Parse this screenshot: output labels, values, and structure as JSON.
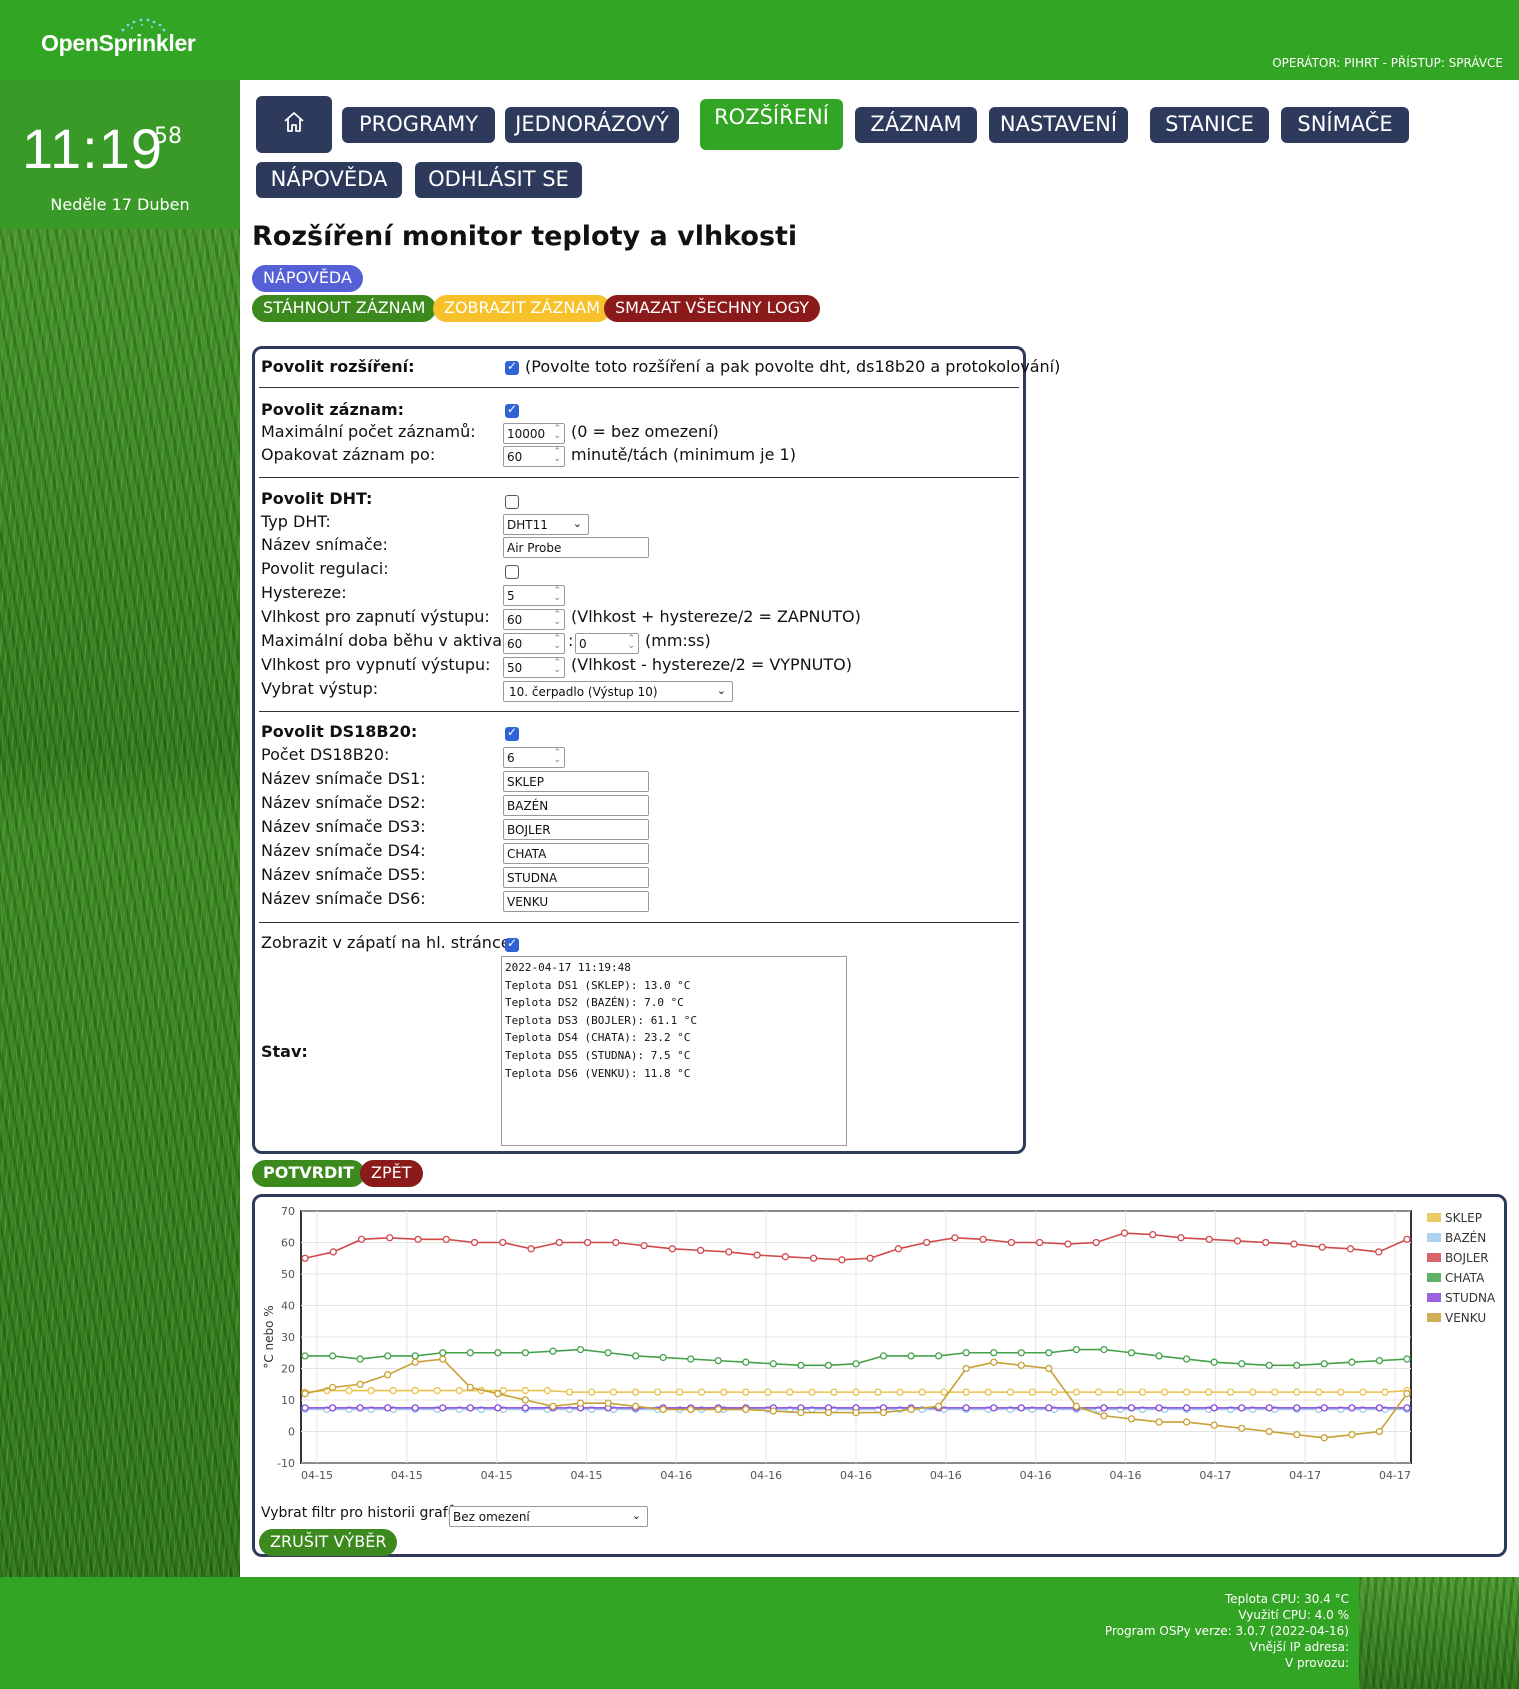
{
  "header": {
    "logo": "OpenSprinkler",
    "operator": "OPERÁTOR: PIHRT - PŘÍSTUP: SPRÁVCE"
  },
  "clock": {
    "time": "11:19",
    "seconds": "58",
    "date": "Neděle 17 Duben"
  },
  "nav": {
    "home_icon": "home-icon",
    "items": [
      "PROGRAMY",
      "JEDNORÁZOVÝ",
      "ROZŠÍŘENÍ",
      "ZÁZNAM",
      "NASTAVENÍ",
      "STANICE",
      "SNÍMAČE",
      "NÁPOVĚDA",
      "ODHLÁSIT SE"
    ],
    "active": "ROZŠÍŘENÍ"
  },
  "page": {
    "title": "Rozšíření monitor teploty a vlhkosti",
    "help_button": "NÁPOVĚDA",
    "download_log": "STÁHNOUT ZÁZNAM",
    "show_log": "ZOBRAZIT ZÁZNAM",
    "delete_logs": "SMAZAT VŠECHNY LOGY",
    "colors": {
      "help": "#5560d6",
      "download": "#3c8a1e",
      "show": "#f7c12b",
      "delete": "#8b1a1a",
      "nav": "#2e3a5c",
      "accent": "#33a524"
    }
  },
  "form": {
    "enable_label": "Povolit rozšíření:",
    "enable_checked": true,
    "enable_note": "(Povolte toto rozšíření a pak povolte dht, ds18b20 a protokolování)",
    "log_enable_label": "Povolit záznam:",
    "log_enable_checked": true,
    "max_records_label": "Maximální počet záznamů:",
    "max_records": "10000",
    "max_records_note": "(0 = bez omezení)",
    "repeat_label": "Opakovat záznam po:",
    "repeat": "60",
    "repeat_note": "minutě/tách (minimum je 1)",
    "dht_enable_label": "Povolit DHT:",
    "dht_enable_checked": false,
    "dht_type_label": "Typ DHT:",
    "dht_type": "DHT11",
    "sensor_name_label": "Název snímače:",
    "sensor_name": "Air Probe",
    "regulation_label": "Povolit regulaci:",
    "regulation_checked": false,
    "hysteresis_label": "Hystereze:",
    "hysteresis": "5",
    "humid_on_label": "Vlhkost pro zapnutí výstupu:",
    "humid_on": "60",
    "humid_on_note": "(Vlhkost + hystereze/2 = ZAPNUTO)",
    "max_run_label": "Maximální doba běhu v aktivaci:",
    "max_run_min": "60",
    "max_run_sep": ":",
    "max_run_sec": "0",
    "max_run_note": "(mm:ss)",
    "humid_off_label": "Vlhkost pro vypnutí výstupu:",
    "humid_off": "50",
    "humid_off_note": "(Vlhkost - hystereze/2 = VYPNUTO)",
    "output_label": "Vybrat výstup:",
    "output": "10. čerpadlo (Výstup 10)",
    "ds_enable_label": "Povolit DS18B20:",
    "ds_enable_checked": true,
    "ds_count_label": "Počet DS18B20:",
    "ds_count": "6",
    "ds_sensors": [
      {
        "label": "Název snímače DS1:",
        "value": "SKLEP"
      },
      {
        "label": "Název snímače DS2:",
        "value": "BAZÉN"
      },
      {
        "label": "Název snímače DS3:",
        "value": "BOJLER"
      },
      {
        "label": "Název snímače DS4:",
        "value": "CHATA"
      },
      {
        "label": "Název snímače DS5:",
        "value": "STUDNA"
      },
      {
        "label": "Název snímače DS6:",
        "value": "VENKU"
      }
    ],
    "footer_show_label": "Zobrazit v zápatí na hl. stránce:",
    "footer_show_checked": true,
    "status_label": "Stav:",
    "status_text": "2022-04-17 11:19:48\nTeplota DS1 (SKLEP): 13.0 °C\nTeplota DS2 (BAZÉN): 7.0 °C\nTeplota DS3 (BOJLER): 61.1 °C\nTeplota DS4 (CHATA): 23.2 °C\nTeplota DS5 (STUDNA): 7.5 °C\nTeplota DS6 (VENKU): 11.8 °C",
    "submit": "POTVRDIT",
    "back": "ZPĚT"
  },
  "chart_filter": {
    "label": "Vybrat filtr pro historii grafů:",
    "value": "Bez omezení",
    "clear_button": "ZRUŠIT VÝBĚR"
  },
  "chart_data": {
    "type": "line",
    "ylabel": "°C nebo %",
    "ylim": [
      -10,
      70
    ],
    "yticks": [
      -10,
      0,
      10,
      20,
      30,
      40,
      50,
      60,
      70
    ],
    "xticks": [
      "04-15",
      "04-15",
      "04-15",
      "04-15",
      "04-16",
      "04-16",
      "04-16",
      "04-16",
      "04-16",
      "04-16",
      "04-17",
      "04-17",
      "04-17"
    ],
    "grid": true,
    "legend_position": "right",
    "x": [
      0,
      1,
      2,
      3,
      4,
      5,
      6,
      7,
      8,
      9,
      10,
      11,
      12,
      13,
      14,
      15,
      16,
      17,
      18,
      19,
      20,
      21,
      22,
      23,
      24,
      25,
      26,
      27,
      28,
      29,
      30,
      31,
      32,
      33,
      34,
      35,
      36,
      37,
      38,
      39,
      40,
      41,
      42,
      43,
      44,
      45,
      46,
      47,
      48,
      49,
      50
    ],
    "series": [
      {
        "name": "SKLEP",
        "color": "#e8c24a",
        "values": [
          12.5,
          13,
          13,
          13,
          13,
          13,
          13,
          13,
          13,
          13,
          13,
          13,
          12.5,
          12.5,
          12.5,
          12.5,
          12.5,
          12.5,
          12.5,
          12.5,
          12.5,
          12.5,
          12.5,
          12.5,
          12.5,
          12.5,
          12.5,
          12.5,
          12.5,
          12.5,
          12.5,
          12.5,
          12.5,
          12.5,
          12.5,
          12.5,
          12.5,
          12.5,
          12.5,
          12.5,
          12.5,
          12.5,
          12.5,
          12.5,
          12.5,
          12.5,
          12.5,
          12.5,
          12.5,
          12.5,
          13
        ]
      },
      {
        "name": "BAZÉN",
        "color": "#9ecbee",
        "values": [
          7,
          7,
          7,
          7,
          7,
          7,
          7,
          7,
          7,
          7,
          7,
          7,
          7,
          7,
          7,
          7,
          7,
          7,
          7,
          7,
          7,
          7,
          7,
          7,
          7,
          7,
          7,
          7,
          7,
          7,
          7,
          7,
          7,
          7,
          7,
          7,
          7,
          7,
          7,
          7,
          7,
          7,
          7,
          7,
          7,
          7,
          7,
          7,
          7,
          7,
          7
        ]
      },
      {
        "name": "BOJLER",
        "color": "#d1494d",
        "values": [
          55,
          57,
          61,
          61.5,
          61,
          61,
          60,
          60,
          58,
          60,
          60,
          60,
          59,
          58,
          57.5,
          57,
          56,
          55.5,
          55,
          54.5,
          55,
          58,
          60,
          61.5,
          61,
          60,
          60,
          59.5,
          60,
          63,
          62.5,
          61.5,
          61,
          60.5,
          60,
          59.5,
          58.5,
          58,
          57,
          61
        ]
      },
      {
        "name": "CHATA",
        "color": "#44a24a",
        "values": [
          24,
          24,
          23,
          24,
          24,
          25,
          25,
          25,
          25,
          25.5,
          26,
          25,
          24,
          23.5,
          23,
          22.5,
          22,
          21.5,
          21,
          21,
          21.5,
          24,
          24,
          24,
          25,
          25,
          25,
          25,
          26,
          26,
          25,
          24,
          23,
          22,
          21.5,
          21,
          21,
          21.5,
          22,
          22.5,
          23
        ]
      },
      {
        "name": "STUDNA",
        "color": "#8b45d9",
        "values": [
          7.5,
          7.5,
          7.5,
          7.5,
          7.5,
          7.5,
          7.5,
          7.5,
          7.5,
          7.5,
          7.5,
          7.5,
          7.5,
          7.5,
          7.5,
          7.5,
          7.5,
          7.5,
          7.5,
          7.5,
          7.5,
          7.5,
          7.5,
          7.5,
          7.5,
          7.5,
          7.5,
          7.5,
          7.5,
          7.5,
          7.5,
          7.5,
          7.5,
          7.5,
          7.5,
          7.5,
          7.5,
          7.5,
          7.5,
          7.5,
          7.5
        ]
      },
      {
        "name": "VENKU",
        "color": "#c8a035",
        "values": [
          12,
          14,
          15,
          18,
          22,
          23,
          14,
          12,
          10,
          8,
          9,
          9,
          8,
          7,
          7,
          7,
          7,
          6.5,
          6,
          6,
          6,
          6,
          7,
          8,
          20,
          22,
          21,
          20,
          8,
          5,
          4,
          3,
          3,
          2,
          1,
          0,
          -1,
          -2,
          -1,
          0,
          12
        ]
      }
    ]
  }
}
